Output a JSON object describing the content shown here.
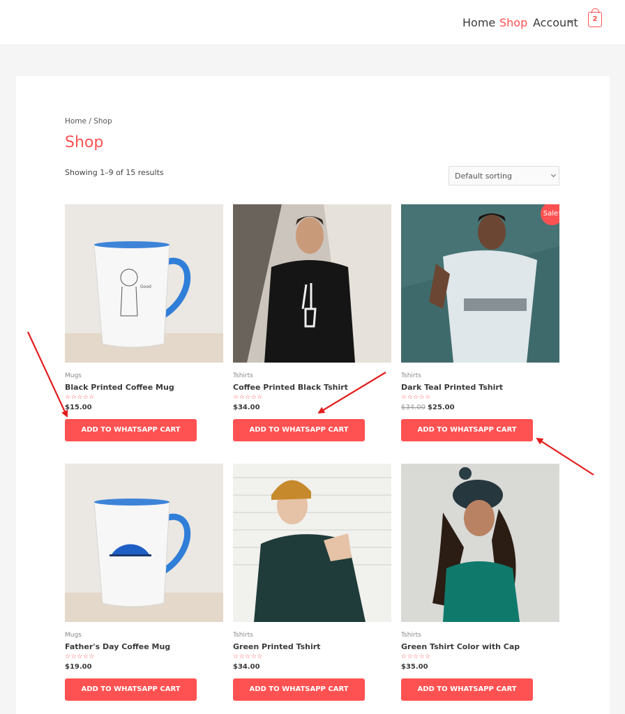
{
  "header": {
    "nav": [
      "Home",
      "Shop",
      "Account"
    ],
    "cart_count": "2"
  },
  "breadcrumb": {
    "home": "Home",
    "sep": " / ",
    "current": "Shop"
  },
  "page_title": "Shop",
  "results_text": "Showing 1–9 of 15 results",
  "sort": {
    "selected": "Default sorting"
  },
  "button_label": "ADD TO WHATSAPP CART",
  "sale_label": "Sale!",
  "products": [
    {
      "category": "Mugs",
      "name": "Black Printed Coffee Mug",
      "rating": "☆☆☆☆☆",
      "price": "$15.00",
      "old_price": ""
    },
    {
      "category": "Tshirts",
      "name": "Coffee Printed Black Tshirt",
      "rating": "☆☆☆☆☆",
      "price": "$34.00",
      "old_price": ""
    },
    {
      "category": "Tshirts",
      "name": "Dark Teal Printed Tshirt",
      "rating": "☆☆☆☆☆",
      "price": "$25.00",
      "old_price": "$34.00"
    },
    {
      "category": "Mugs",
      "name": "Father's Day Coffee Mug",
      "rating": "☆☆☆☆☆",
      "price": "$19.00",
      "old_price": ""
    },
    {
      "category": "Tshirts",
      "name": "Green Printed Tshirt",
      "rating": "☆☆☆☆☆",
      "price": "$34.00",
      "old_price": ""
    },
    {
      "category": "Tshirts",
      "name": "Green Tshirt Color with Cap",
      "rating": "☆☆☆☆☆",
      "price": "$35.00",
      "old_price": ""
    }
  ],
  "colors": {
    "accent": "#fe5252",
    "arrow": "#e21d1d"
  }
}
